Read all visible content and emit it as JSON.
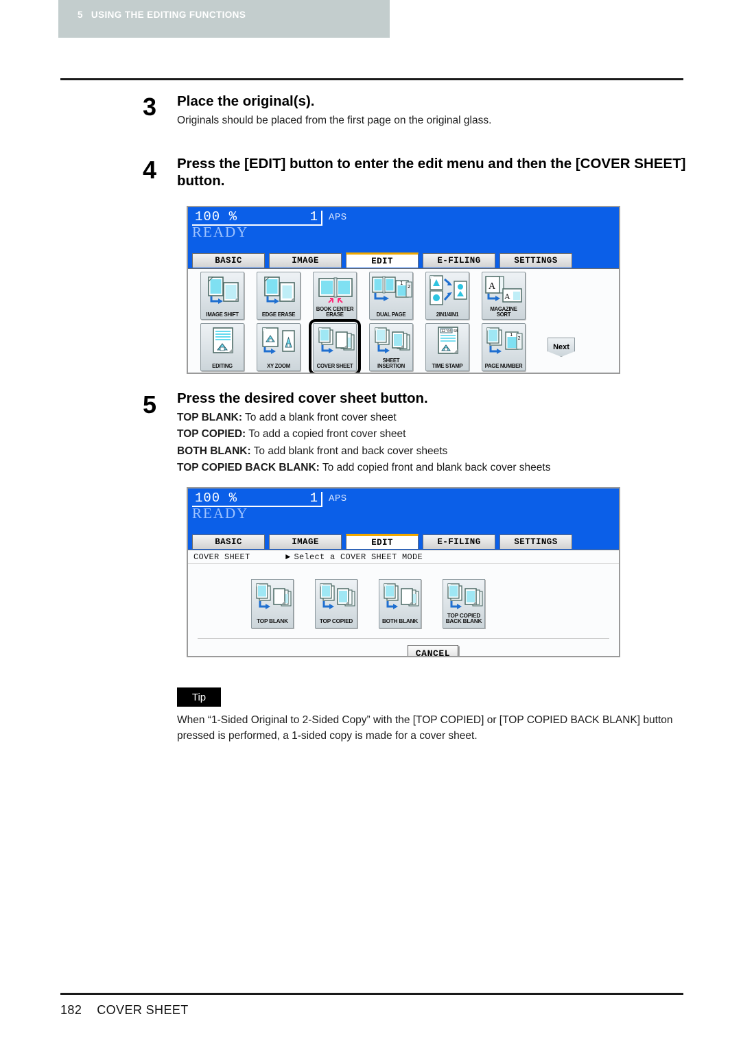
{
  "header": {
    "chapter_number": "5",
    "chapter_title": "USING THE EDITING FUNCTIONS"
  },
  "steps": [
    {
      "number": "3",
      "title": "Place the original(s).",
      "body": "Originals should be placed from the first page on the original glass."
    },
    {
      "number": "4",
      "title": "Press the [EDIT] button to enter the edit menu and then the [COVER SHEET] button."
    },
    {
      "number": "5",
      "title": "Press the desired cover sheet button.",
      "lines": [
        {
          "label": "TOP BLANK:",
          "desc": " To add a blank front cover sheet"
        },
        {
          "label": "TOP COPIED:",
          "desc": " To add a copied front cover sheet"
        },
        {
          "label": "BOTH BLANK:",
          "desc": " To add blank front and back cover sheets"
        },
        {
          "label": "TOP COPIED BACK BLANK:",
          "desc": " To add copied front and blank back cover sheets"
        }
      ]
    }
  ],
  "panel_edit": {
    "status": {
      "ratio": "100",
      "percent_symbol": "%",
      "copies": "1",
      "paper_mode": "APS",
      "state": "READY"
    },
    "tabs": [
      {
        "label": "BASIC",
        "active": false
      },
      {
        "label": "IMAGE",
        "active": false
      },
      {
        "label": "EDIT",
        "active": true
      },
      {
        "label": "E-FILING",
        "active": false
      },
      {
        "label": "SETTINGS",
        "active": false
      }
    ],
    "buttons_row1": [
      {
        "label": "IMAGE SHIFT",
        "icon": "image-shift-icon"
      },
      {
        "label": "EDGE ERASE",
        "icon": "edge-erase-icon"
      },
      {
        "label": "BOOK CENTER\nERASE",
        "icon": "book-center-erase-icon"
      },
      {
        "label": "DUAL  PAGE",
        "icon": "dual-page-icon"
      },
      {
        "label": "2IN1/4IN1",
        "icon": "nin1-icon"
      },
      {
        "label": "MAGAZINE SORT",
        "icon": "magazine-sort-icon"
      }
    ],
    "buttons_row2": [
      {
        "label": "EDITING",
        "icon": "editing-icon"
      },
      {
        "label": "XY ZOOM",
        "icon": "xy-zoom-icon"
      },
      {
        "label": "COVER SHEET",
        "icon": "cover-sheet-icon",
        "selected": true
      },
      {
        "label": "SHEET\nINSERTION",
        "icon": "sheet-insertion-icon"
      },
      {
        "label": "TIME STAMP",
        "icon": "time-stamp-icon"
      },
      {
        "label": "PAGE NUMBER",
        "icon": "page-number-icon"
      }
    ],
    "next_label": "Next"
  },
  "panel_cover": {
    "status": {
      "ratio": "100",
      "percent_symbol": "%",
      "copies": "1",
      "paper_mode": "APS",
      "state": "READY"
    },
    "tabs": [
      {
        "label": "BASIC",
        "active": false
      },
      {
        "label": "IMAGE",
        "active": false
      },
      {
        "label": "EDIT",
        "active": true
      },
      {
        "label": "E-FILING",
        "active": false
      },
      {
        "label": "SETTINGS",
        "active": false
      }
    ],
    "subbar": {
      "title": "COVER SHEET",
      "prompt": "Select a COVER SHEET MODE"
    },
    "mode_buttons": [
      {
        "label": "TOP  BLANK",
        "icon": "top-blank-icon"
      },
      {
        "label": "TOP COPIED",
        "icon": "top-copied-icon"
      },
      {
        "label": "BOTH BLANK",
        "icon": "both-blank-icon"
      },
      {
        "label": "TOP COPIED\nBACK BLANK",
        "icon": "top-copied-back-blank-icon"
      }
    ],
    "cancel_label": "CANCEL"
  },
  "tip": {
    "badge": "Tip",
    "text": "When “1-Sided Original to 2-Sided Copy” with the [TOP COPIED] or [TOP COPIED BACK BLANK] button pressed is performed, a 1-sided copy is made for a cover sheet."
  },
  "footer": {
    "page_number": "182",
    "section_title": "COVER SHEET"
  },
  "colors": {
    "lcd_blue": "#0b5fe8",
    "tab_active_accent": "#f0a800",
    "chapter_bar": "#c3cdcd",
    "icon_cyan": "#6fdcef"
  }
}
